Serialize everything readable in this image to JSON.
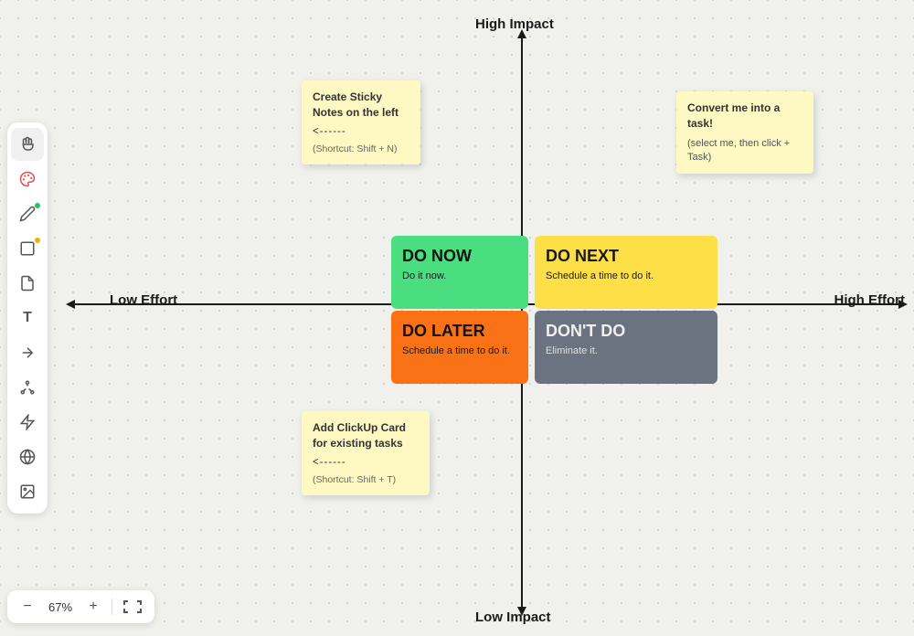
{
  "toolbar": {
    "items": [
      {
        "name": "hand-tool",
        "icon": "✋",
        "dot": null
      },
      {
        "name": "paint-tool",
        "icon": "🎨",
        "dot": null
      },
      {
        "name": "pencil-tool",
        "icon": "✏",
        "dot": "green"
      },
      {
        "name": "shape-tool",
        "icon": "□",
        "dot": "yellow"
      },
      {
        "name": "sticky-tool",
        "icon": "🗒",
        "dot": null
      },
      {
        "name": "text-tool",
        "icon": "T",
        "dot": null
      },
      {
        "name": "arrow-tool",
        "icon": "↗",
        "dot": null
      },
      {
        "name": "connect-tool",
        "icon": "⚙",
        "dot": null
      },
      {
        "name": "ai-tool",
        "icon": "✦",
        "dot": null
      },
      {
        "name": "globe-tool",
        "icon": "🌐",
        "dot": null
      },
      {
        "name": "image-tool",
        "icon": "🖼",
        "dot": null
      }
    ]
  },
  "zoom": {
    "minus_label": "−",
    "value": "67%",
    "plus_label": "+",
    "fit_icon": "⇔"
  },
  "axes": {
    "high_impact": "High Impact",
    "low_impact": "Low Impact",
    "low_effort": "Low Effort",
    "high_effort": "High Effort"
  },
  "quadrants": {
    "do_now": {
      "title": "DO NOW",
      "subtitle": "Do it now."
    },
    "do_next": {
      "title": "DO NEXT",
      "subtitle": "Schedule a time to do it."
    },
    "do_later": {
      "title": "DO LATER",
      "subtitle": "Schedule a time to do it."
    },
    "dont_do": {
      "title": "DON'T DO",
      "subtitle": "Eliminate it."
    }
  },
  "sticky_notes": {
    "note1": {
      "title": "Create Sticky Notes on the left",
      "dash": "<------",
      "shortcut": "(Shortcut: Shift + N)"
    },
    "note2": {
      "title": "Convert me into a task!",
      "sub": "(select me, then click + Task)"
    },
    "note3": {
      "title": "Add ClickUp Card for existing tasks",
      "dash": "<------",
      "shortcut": "(Shortcut: Shift + T)"
    }
  }
}
